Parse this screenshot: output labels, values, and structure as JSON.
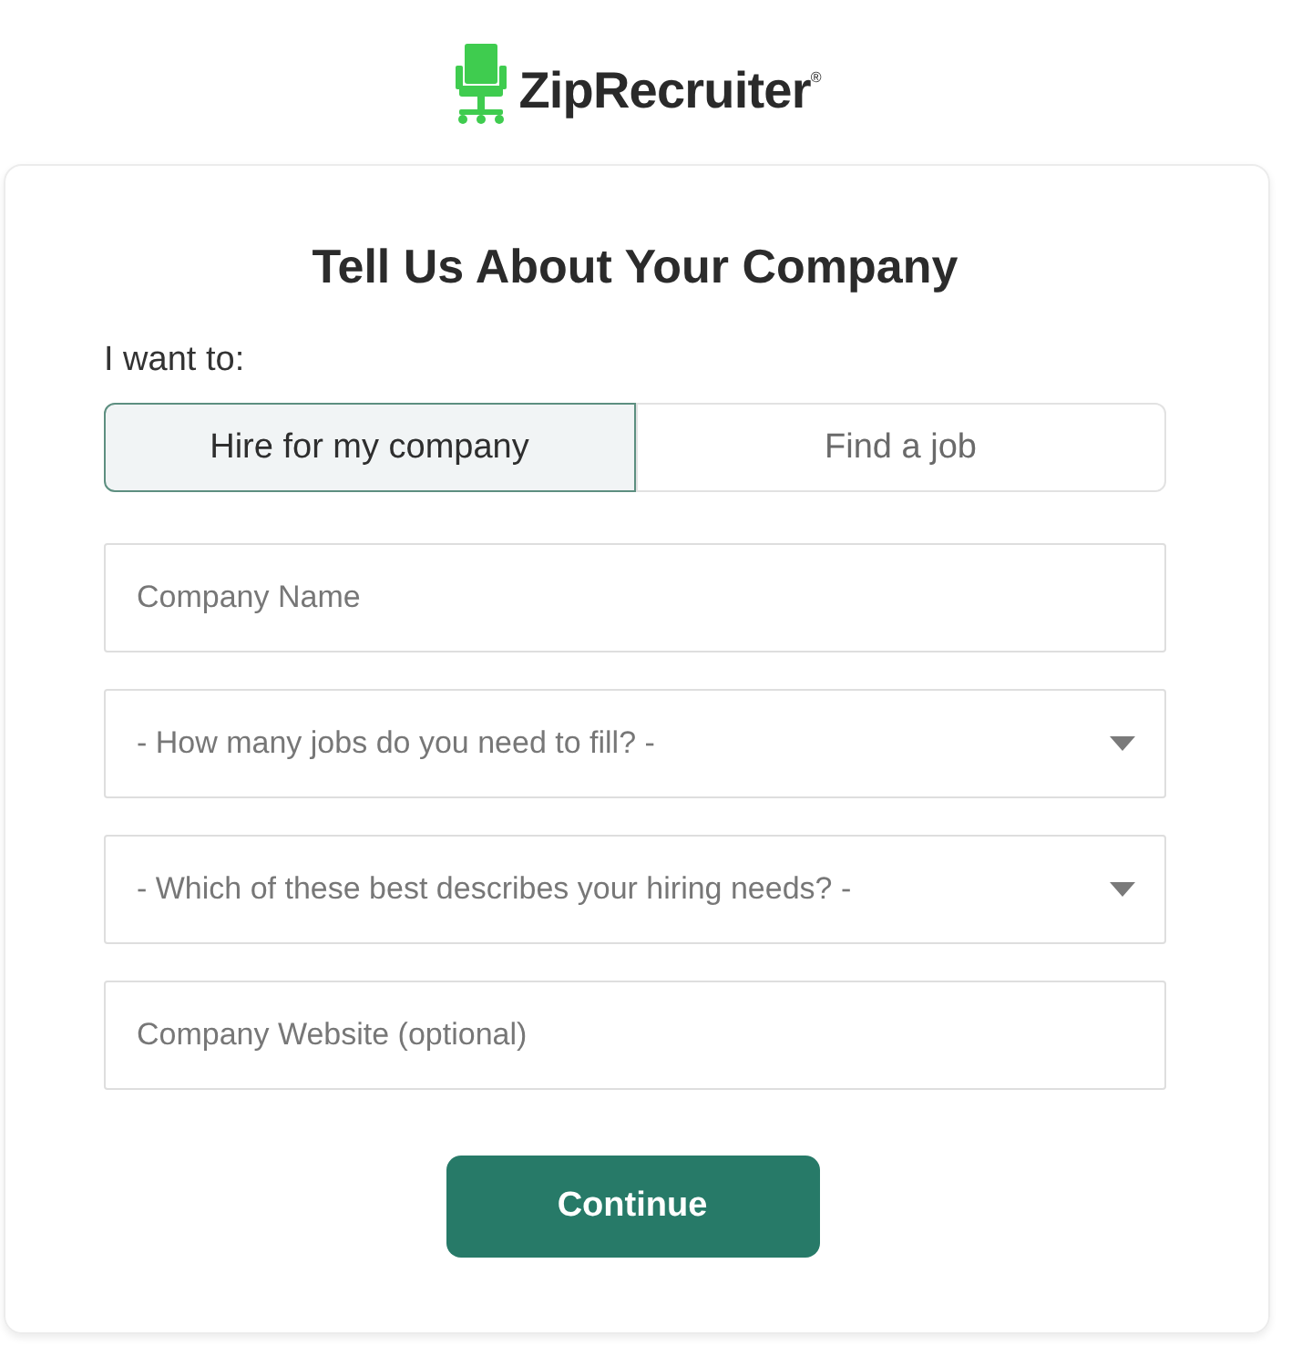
{
  "logo": {
    "text": "ZipRecruiter$^{®}$"
  },
  "form": {
    "title": "Tell Us About Your Company",
    "intent_label": "I want to:",
    "intent_options": [
      {
        "label": "Hire for my company",
        "selected": true
      },
      {
        "label": "Find a job",
        "selected": false
      }
    ],
    "fields": [
      {
        "kind": "text",
        "placeholder": "Company Name"
      },
      {
        "kind": "select",
        "placeholder": "- How many jobs do you need to fill? -"
      },
      {
        "kind": "select",
        "placeholder": "- Which of these best describes your hiring needs? -"
      },
      {
        "kind": "text",
        "placeholder": "Company Website (optional)"
      }
    ],
    "submit": "Continue"
  }
}
